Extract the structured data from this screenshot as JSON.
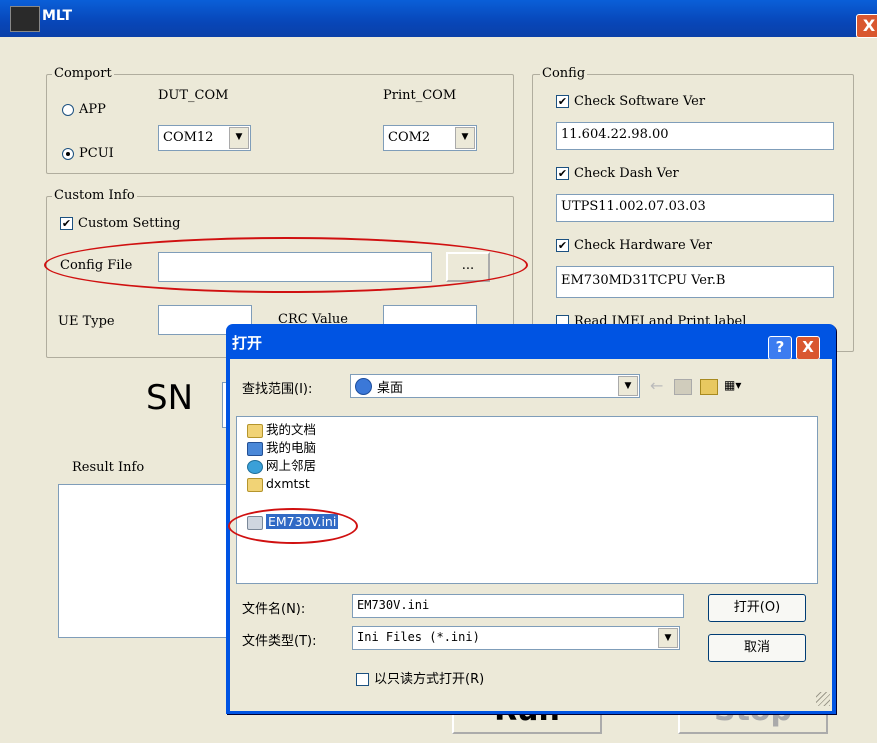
{
  "window": {
    "title": "MLT",
    "close_glyph": "X"
  },
  "comport": {
    "label": "Comport",
    "options": [
      "APP",
      "PCUI"
    ],
    "selected": "PCUI",
    "dut_com_label": "DUT_COM",
    "dut_com_value": "COM12",
    "print_com_label": "Print_COM",
    "print_com_value": "COM2"
  },
  "custom_info": {
    "label": "Custom Info",
    "custom_setting_label": "Custom Setting",
    "custom_setting_checked": true,
    "config_file_label": "Config File",
    "config_file_value": "",
    "browse_label": "...",
    "ue_type_label": "UE Type",
    "crc_value_label": "CRC Value"
  },
  "config": {
    "label": "Config",
    "check_software_label": "Check Software Ver",
    "software_ver": "11.604.22.98.00",
    "check_dash_label": "Check Dash Ver",
    "dash_ver": "UTPS11.002.07.03.03",
    "check_hardware_label": "Check  Hardware Ver",
    "hardware_ver": "EM730MD31TCPU Ver.B",
    "read_imei_label": "Read IMEI and Print label"
  },
  "main": {
    "sn_label": "SN",
    "result_info_label": "Result Info",
    "run_label": "Run",
    "stop_label": "Stop"
  },
  "dialog": {
    "title": "打开",
    "help_glyph": "?",
    "close_glyph": "X",
    "look_in_label": "查找范围(I):",
    "look_in_value": "桌面",
    "files": [
      {
        "name": "我的文档",
        "icon": "my-documents-icon"
      },
      {
        "name": "我的电脑",
        "icon": "my-computer-icon"
      },
      {
        "name": "网上邻居",
        "icon": "network-places-icon"
      },
      {
        "name": "dxmtst",
        "icon": "folder-icon"
      },
      {
        "name": "EM730V.ini",
        "icon": "ini-file-icon",
        "selected": true
      }
    ],
    "filename_label": "文件名(N):",
    "filename_value": "EM730V.ini",
    "filetype_label": "文件类型(T):",
    "filetype_value": "Ini Files (*.ini)",
    "readonly_label": "以只读方式打开(R)",
    "open_button": "打开(O)",
    "cancel_button": "取消"
  },
  "colors": {
    "xp_blue": "#0054e3",
    "highlight": "#316ac5",
    "annotation_red": "#d01010"
  }
}
